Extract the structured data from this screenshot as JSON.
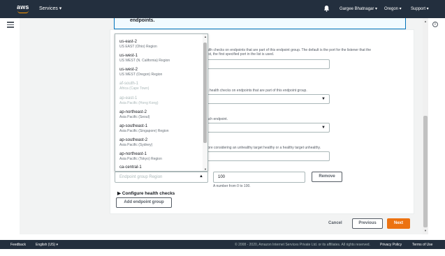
{
  "topbar": {
    "logo": "aws",
    "services_label": "Services ▾",
    "user_label": "Gargee Bhatnagar ▾",
    "region_label": "Oregon ▾",
    "support_label": "Support ▾",
    "bg_color": "#232f3e",
    "accent_color": "#ff9900"
  },
  "alert": {
    "text": "endpoints."
  },
  "form": {
    "port_help_1": "alth checks on endpoints that are part of this endpoint group. The default is the port for the listener that the",
    "port_help_2": "list, the first specified port in the list is used.",
    "protocol_help": "s health checks on endpoints that are part of this endpoint group.",
    "interval_help": "ach endpoint.",
    "threshold_help": "fore considering an unhealthy target healthy or a healthy target unhealthy."
  },
  "dropdown": {
    "items": [
      {
        "name": "us-east-2",
        "desc": "US EAST (Ohio) Region",
        "disabled": false
      },
      {
        "name": "us-west-1",
        "desc": "US WEST (N. California) Region",
        "disabled": false
      },
      {
        "name": "us-west-2",
        "desc": "US WEST (Oregon) Region",
        "disabled": false
      },
      {
        "name": "af-south-1",
        "desc": "Africa (Cape Town)",
        "disabled": true
      },
      {
        "name": "ap-east-1",
        "desc": "Asia Pacific (Hong Kong)",
        "disabled": true
      },
      {
        "name": "ap-northeast-2",
        "desc": "Asia Pacific (Seoul)",
        "disabled": false
      },
      {
        "name": "ap-southeast-1",
        "desc": "Asia Pacific (Singapore) Region",
        "disabled": false
      },
      {
        "name": "ap-southeast-2",
        "desc": "Asia Pacific (Sydney)",
        "disabled": false
      },
      {
        "name": "ap-northeast-1",
        "desc": "Asia Pacific (Tokyo) Region",
        "disabled": false
      },
      {
        "name": "ca-central-1",
        "desc": "",
        "disabled": false
      }
    ]
  },
  "endpoint_group": {
    "region_placeholder": "Endpoint group Region",
    "traffic_dial_value": "100",
    "traffic_dial_help": "A number from 0 to 100.",
    "remove_label": "Remove",
    "configure_health_checks_label": "Configure health checks",
    "add_endpoint_group_label": "Add endpoint group"
  },
  "actions": {
    "cancel_label": "Cancel",
    "previous_label": "Previous",
    "next_label": "Next",
    "primary_color": "#ec7211"
  },
  "footer": {
    "feedback_label": "Feedback",
    "language_label": "English (US) ▾",
    "copyright": "© 2008 - 2020, Amazon Internet Services Private Ltd. or its affiliates. All rights reserved.",
    "privacy_label": "Privacy Policy",
    "terms_label": "Terms of Use"
  }
}
